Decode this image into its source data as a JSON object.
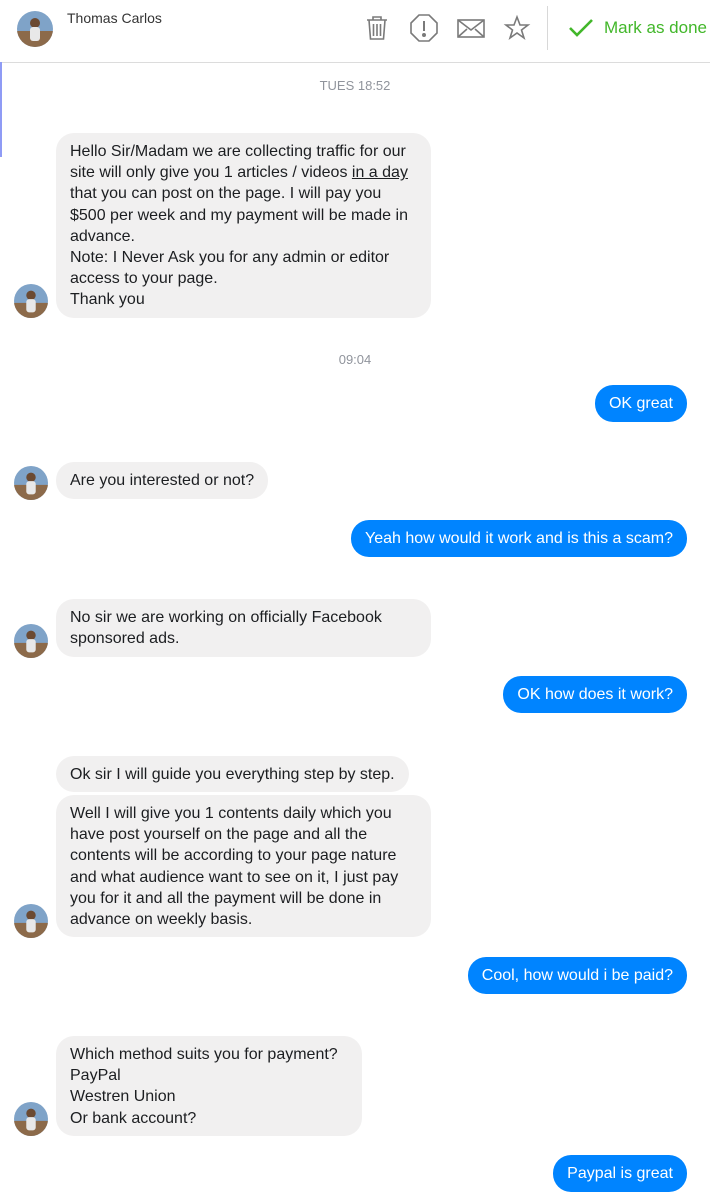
{
  "header": {
    "contact_name": "Thomas Carlos",
    "actions": [
      {
        "icon": "trash-icon"
      },
      {
        "icon": "alert-icon"
      },
      {
        "icon": "envelope-icon"
      },
      {
        "icon": "star-icon"
      }
    ],
    "mark_done_label": "Mark as done",
    "accent_color": "#42b72a"
  },
  "conversation": {
    "timestamps": [
      "TUES 18:52",
      "09:04"
    ],
    "messages": [
      {
        "from": "contact",
        "lines": [
          "Hello Sir/Madam we are collecting traffic for our",
          "site will only give you 1 articles / videos ",
          "in a day",
          "that you can post on the page. I will pay you",
          "$500 per week and my payment will be made in",
          "advance.",
          "Note: I Never Ask you for any admin or editor",
          "access to your page.",
          "Thank you"
        ]
      },
      {
        "from": "me",
        "text": "OK great"
      },
      {
        "from": "contact",
        "text": "Are you interested or not?"
      },
      {
        "from": "me",
        "text": "Yeah how would it work and is this a scam?"
      },
      {
        "from": "contact",
        "lines": [
          "No sir we are working on officially Facebook",
          "sponsored ads."
        ]
      },
      {
        "from": "me",
        "text": "OK how does it work?"
      },
      {
        "from": "contact",
        "text": "Ok sir I will guide you everything step by step."
      },
      {
        "from": "contact",
        "lines": [
          "Well I will give you 1 contents daily which you",
          "have post yourself on the page and all the",
          "contents will be according to your page nature",
          "and what audience want to see on it, I just pay",
          "you for it and all the payment will be done in",
          "advance on weekly basis."
        ]
      },
      {
        "from": "me",
        "text": "Cool, how would i be paid?"
      },
      {
        "from": "contact",
        "lines": [
          "Which method suits you for payment?",
          "PayPal",
          "Westren Union",
          "Or bank account?"
        ]
      },
      {
        "from": "me",
        "text": "Paypal is great"
      }
    ]
  },
  "colors": {
    "outgoing_bubble": "#0084ff",
    "incoming_bubble": "#f1f0f0"
  }
}
